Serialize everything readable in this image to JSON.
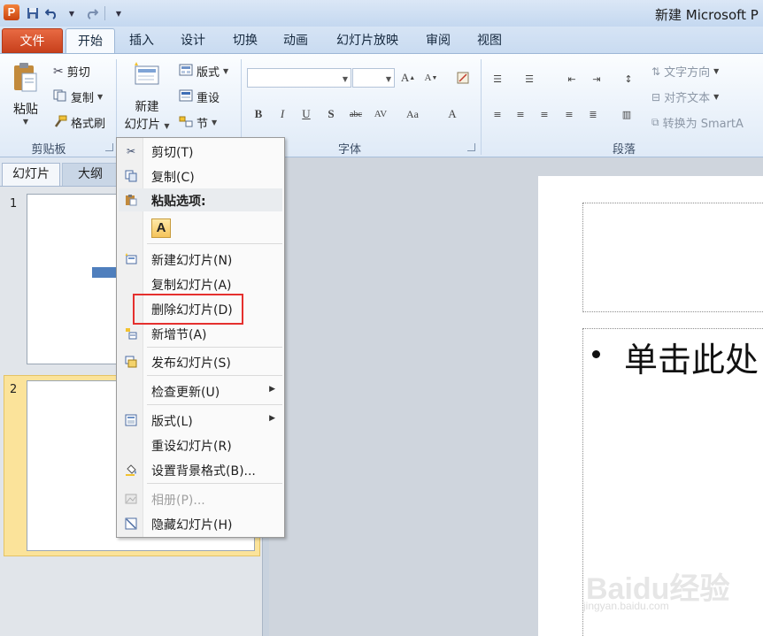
{
  "window": {
    "title": "新建 Microsoft P",
    "app_icon_letter": "P"
  },
  "ribbon_tabs": [
    "文件",
    "开始",
    "插入",
    "设计",
    "切换",
    "动画",
    "幻灯片放映",
    "审阅",
    "视图"
  ],
  "clipboard": {
    "paste_label": "粘贴",
    "cut_label": "剪切",
    "copy_label": "复制",
    "format_painter_label": "格式刷",
    "group_label": "剪贴板"
  },
  "slides_group": {
    "new_slide_line1": "新建",
    "new_slide_line2": "幻灯片",
    "layout_label": "版式",
    "reset_label": "重设",
    "section_label": "节"
  },
  "font_group": {
    "group_label": "字体"
  },
  "paragraph_group": {
    "group_label": "段落",
    "text_direction_label": "文字方向",
    "align_text_label": "对齐文本",
    "convert_smartart_label": "转换为 SmartA"
  },
  "left_panel": {
    "tab_slides": "幻灯片",
    "tab_outline": "大纲",
    "slide_numbers": [
      "1",
      "2"
    ]
  },
  "slide": {
    "body_text": "单击此处"
  },
  "watermark": {
    "logo": "Baidu经验",
    "url": "jingyan.baidu.com"
  },
  "context_menu": {
    "cut": "剪切(T)",
    "copy": "复制(C)",
    "paste_options": "粘贴选项:",
    "paste_keep_text": "A",
    "new_slide": "新建幻灯片(N)",
    "duplicate_slide": "复制幻灯片(A)",
    "delete_slide": "删除幻灯片(D)",
    "add_section": "新增节(A)",
    "publish_slides": "发布幻灯片(S)",
    "check_updates": "检查更新(U)",
    "layout": "版式(L)",
    "reset_slide": "重设幻灯片(R)",
    "format_background": "设置背景格式(B)...",
    "photo_album": "相册(P)...",
    "hide_slide": "隐藏幻灯片(H)"
  },
  "colors": {
    "file_tab": "#d2512b",
    "selected_slide": "#fbe39a",
    "highlight_box": "#e5302e"
  }
}
